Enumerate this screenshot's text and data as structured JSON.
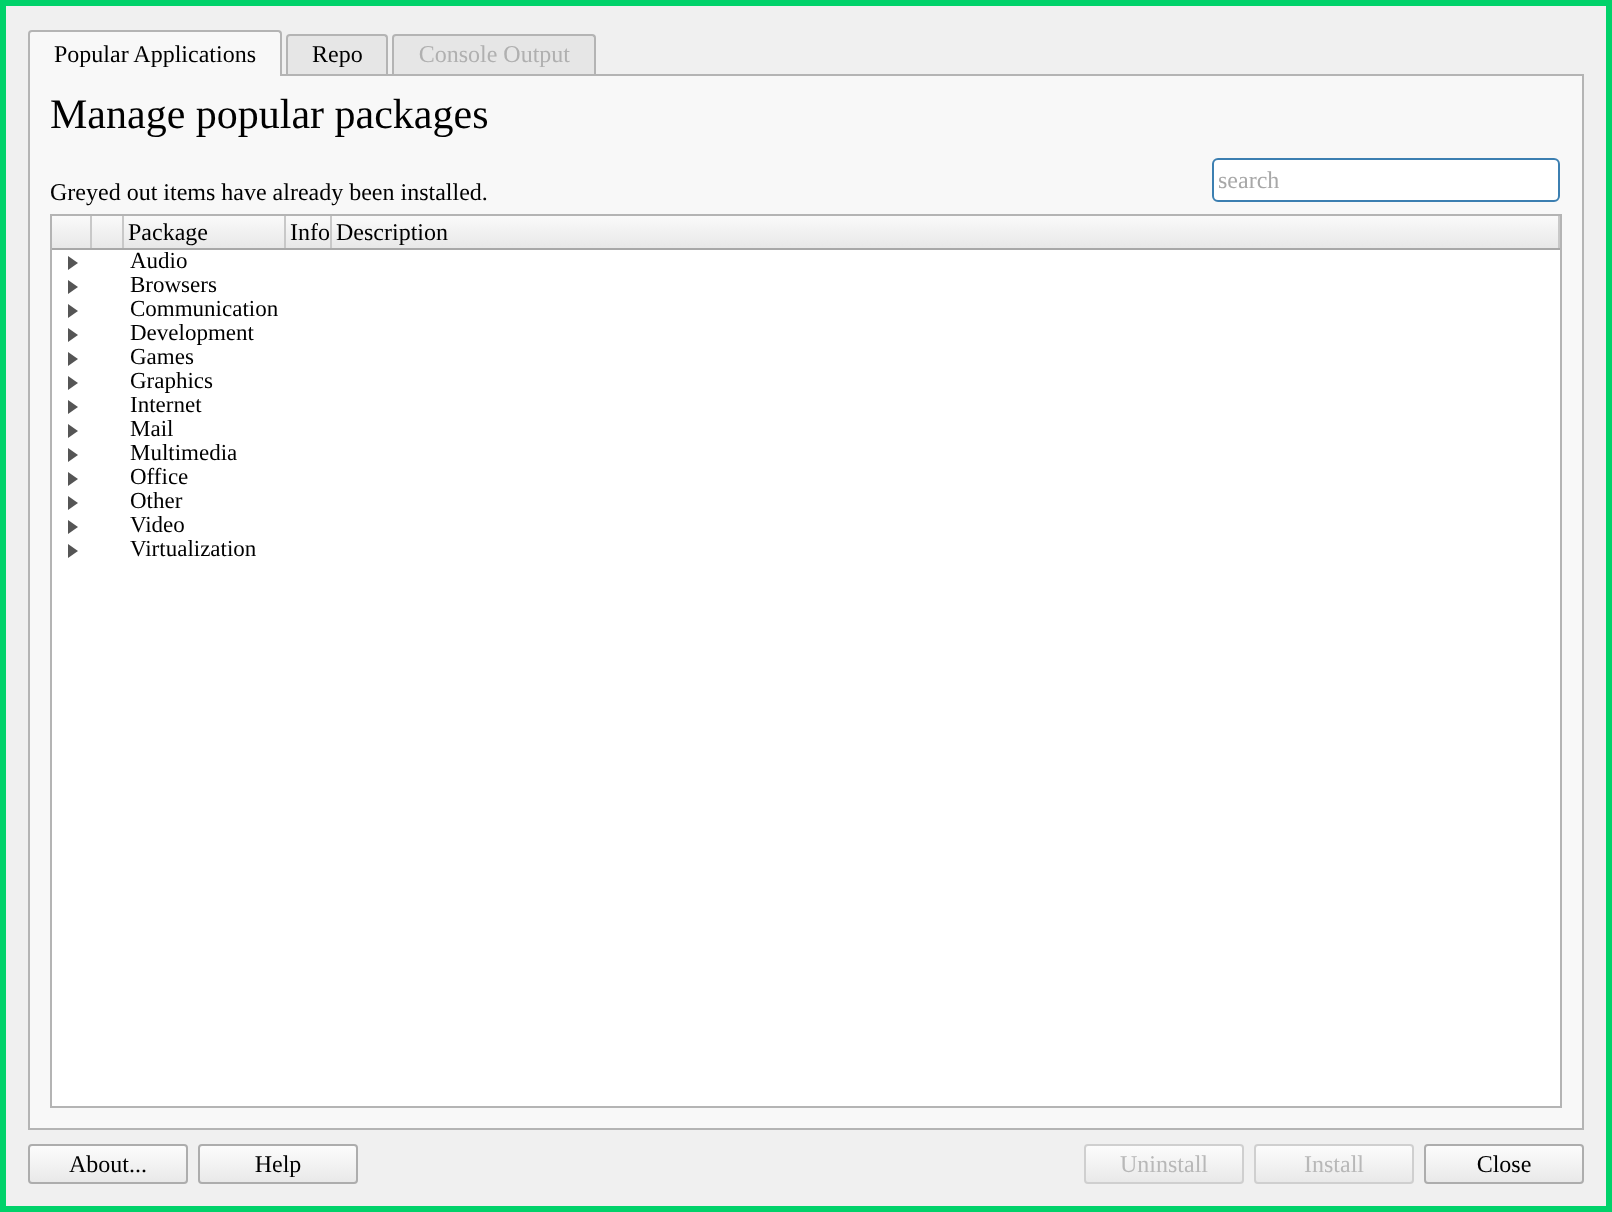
{
  "tabs": [
    {
      "label": "Popular Applications",
      "selected": true,
      "disabled": false
    },
    {
      "label": "Repo",
      "selected": false,
      "disabled": false
    },
    {
      "label": "Console Output",
      "selected": false,
      "disabled": true
    }
  ],
  "heading": "Manage popular packages",
  "note": "Greyed out items have already been installed.",
  "search": {
    "placeholder": "search"
  },
  "tree": {
    "columns": [
      "Package",
      "Info",
      "Description"
    ],
    "items": [
      {
        "label": "Audio",
        "expanded": false
      },
      {
        "label": "Browsers",
        "expanded": false
      },
      {
        "label": "Communication",
        "expanded": false
      },
      {
        "label": "Development",
        "expanded": false
      },
      {
        "label": "Games",
        "expanded": false
      },
      {
        "label": "Graphics",
        "expanded": false
      },
      {
        "label": "Internet",
        "expanded": false
      },
      {
        "label": "Mail",
        "expanded": false
      },
      {
        "label": "Multimedia",
        "expanded": false
      },
      {
        "label": "Office",
        "expanded": false
      },
      {
        "label": "Other",
        "expanded": false
      },
      {
        "label": "Video",
        "expanded": false
      },
      {
        "label": "Virtualization",
        "expanded": false
      }
    ]
  },
  "buttons_left": [
    {
      "label": "About...",
      "disabled": false
    },
    {
      "label": "Help",
      "disabled": false
    }
  ],
  "buttons_right": [
    {
      "label": "Uninstall",
      "disabled": true
    },
    {
      "label": "Install",
      "disabled": true
    },
    {
      "label": "Close",
      "disabled": false
    }
  ]
}
